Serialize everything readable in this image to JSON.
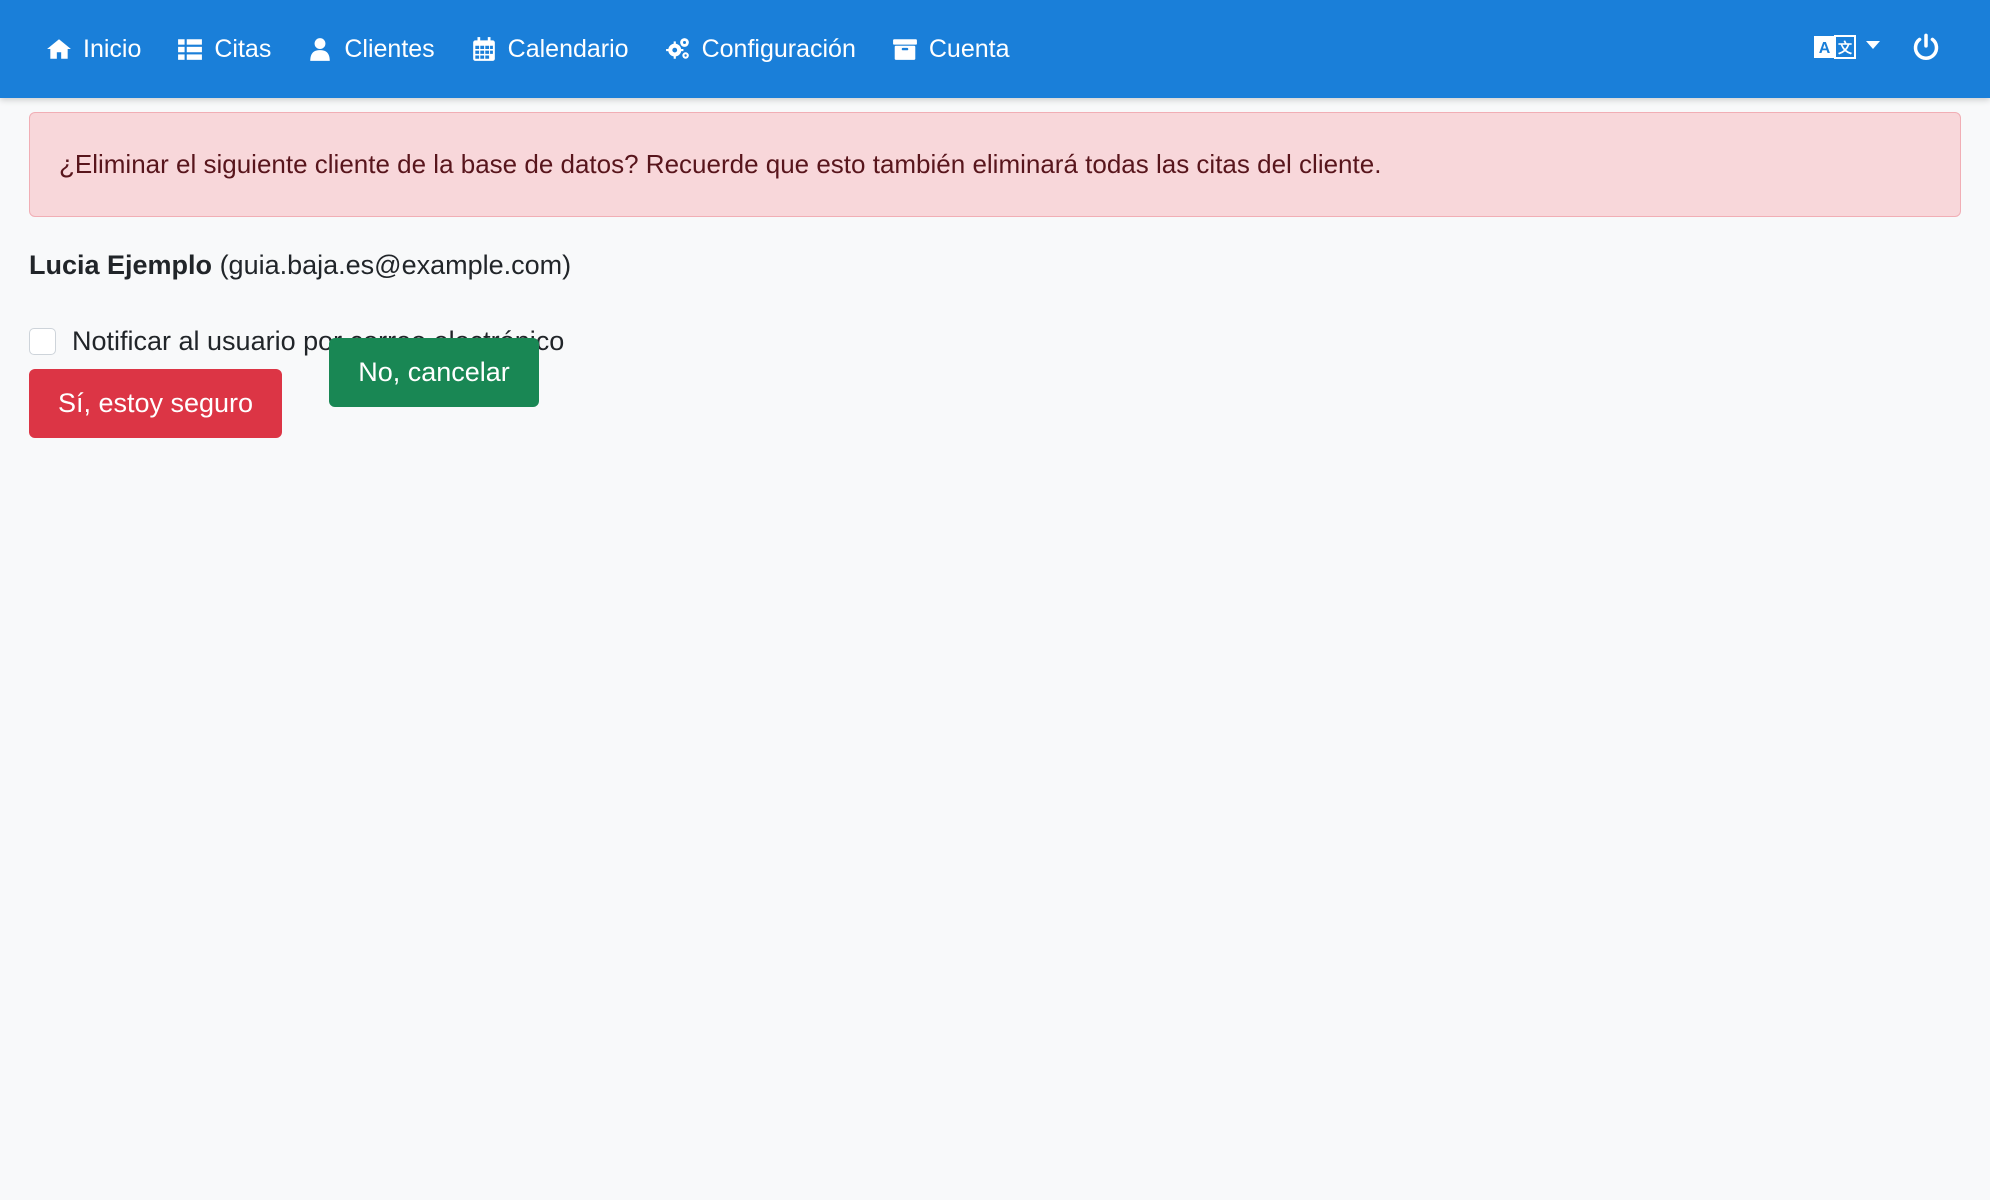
{
  "nav": {
    "items": [
      {
        "label": "Inicio",
        "icon": "home-icon"
      },
      {
        "label": "Citas",
        "icon": "list-icon"
      },
      {
        "label": "Clientes",
        "icon": "user-icon"
      },
      {
        "label": "Calendario",
        "icon": "calendar-icon"
      },
      {
        "label": "Configuración",
        "icon": "cogs-icon"
      },
      {
        "label": "Cuenta",
        "icon": "archive-icon"
      }
    ],
    "language_icon": "language-icon",
    "power_icon": "power-icon"
  },
  "alert": {
    "message": "¿Eliminar el siguiente cliente de la base de datos? Recuerde que esto también eliminará todas las citas del cliente."
  },
  "customer": {
    "name": "Lucia Ejemplo",
    "email_display": "(guia.baja.es@example.com)"
  },
  "notify": {
    "label": "Notificar al usuario por correo electrónico",
    "checked": false
  },
  "buttons": {
    "confirm": "Sí, estoy seguro",
    "cancel": "No, cancelar"
  },
  "colors": {
    "navbar": "#1a7fd9",
    "alert_bg": "#f8d7da",
    "alert_text": "#58151c",
    "danger": "#dc3545",
    "success": "#198754",
    "page_bg": "#f8f9fa"
  }
}
